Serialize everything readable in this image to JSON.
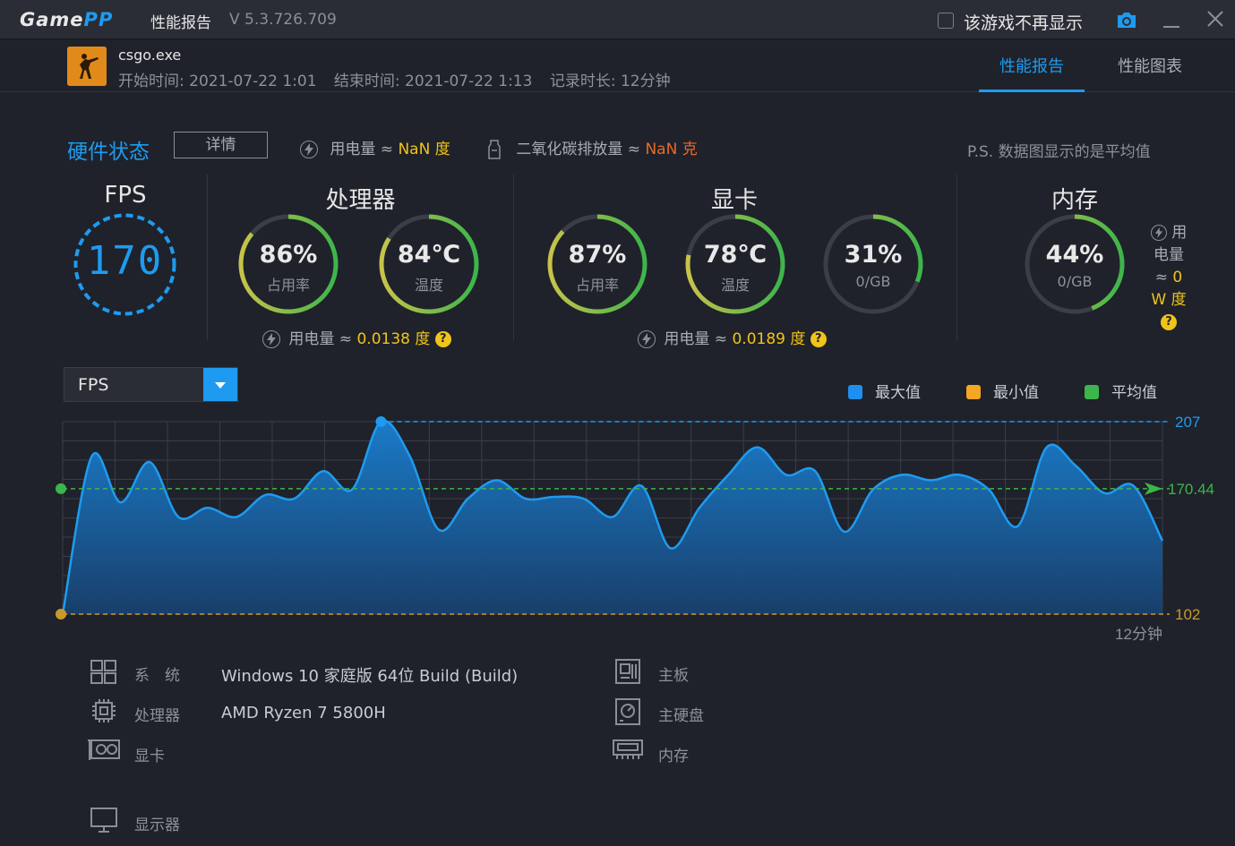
{
  "titlebar": {
    "logo_game": "Game",
    "logo_pp": "PP",
    "title": "性能报告",
    "version": "V 5.3.726.709",
    "dont_show_label": "该游戏不再显示"
  },
  "game": {
    "name": "csgo.exe",
    "start_time": "开始时间: 2021-07-22 1:01",
    "end_time": "结束时间: 2021-07-22 1:13",
    "duration": "记录时长: 12分钟"
  },
  "tabs": {
    "report": "性能报告",
    "chart": "性能图表"
  },
  "hardware": {
    "title": "硬件状态",
    "detail_button": "详情",
    "power_label": "用电量 ≈",
    "power_value": "NaN 度",
    "co2_label": "二氧化碳排放量 ≈",
    "co2_value": "NaN 克",
    "note": "P.S. 数据图显示的是平均值"
  },
  "fps": {
    "title": "FPS",
    "value": "170"
  },
  "cpu": {
    "title": "处理器",
    "usage": {
      "value": "86%",
      "label": "占用率",
      "fraction": 0.86
    },
    "temp": {
      "value": "84℃",
      "label": "温度",
      "fraction": 0.84
    },
    "power_label": "用电量 ≈",
    "power_value": "0.0138 度"
  },
  "gpu": {
    "title": "显卡",
    "usage": {
      "value": "87%",
      "label": "占用率",
      "fraction": 0.87
    },
    "temp": {
      "value": "78℃",
      "label": "温度",
      "fraction": 0.78
    },
    "vram": {
      "value": "31%",
      "label": "0/GB",
      "fraction": 0.31
    },
    "power_label": "用电量 ≈",
    "power_value": "0.0189 度"
  },
  "memory": {
    "title": "内存",
    "usage": {
      "value": "44%",
      "label": "0/GB",
      "fraction": 0.44
    },
    "power_line1": "用",
    "power_line2": "电量",
    "power_line3": "≈ 0",
    "power_line4": "W 度"
  },
  "chart_select": {
    "value": "FPS"
  },
  "legend": {
    "max": "最大值",
    "min": "最小值",
    "avg": "平均值"
  },
  "colors": {
    "accent": "#1e9bf0",
    "max": "#1e8ff0",
    "min": "#f5a623",
    "avg": "#3cb54a",
    "ring_yellow": "#c8c34a",
    "ring_green": "#3cb54a"
  },
  "chart_data": {
    "type": "area",
    "y_max_label": "207",
    "y_avg_label": "170.44",
    "y_min_label": "102",
    "x_end_label": "12分钟",
    "ylim": [
      102,
      207
    ],
    "max": 207,
    "avg": 170.44,
    "min": 102,
    "values": [
      102,
      188,
      163,
      185,
      155,
      160,
      155,
      167,
      165,
      180,
      170,
      207,
      188,
      148,
      165,
      175,
      165,
      166,
      165,
      155,
      172,
      138,
      160,
      178,
      193,
      178,
      180,
      147,
      170,
      178,
      175,
      178,
      170,
      150,
      193,
      183,
      168,
      172,
      142
    ]
  },
  "system": {
    "os_label": "系　统",
    "os_value": "Windows 10 家庭版 64位   Build (Build)",
    "cpu_label": "处理器",
    "cpu_value": "AMD Ryzen 7 5800H",
    "gpu_label": "显卡",
    "board_label": "主板",
    "disk_label": "主硬盘",
    "mem_label": "内存",
    "monitor_label": "显示器"
  }
}
